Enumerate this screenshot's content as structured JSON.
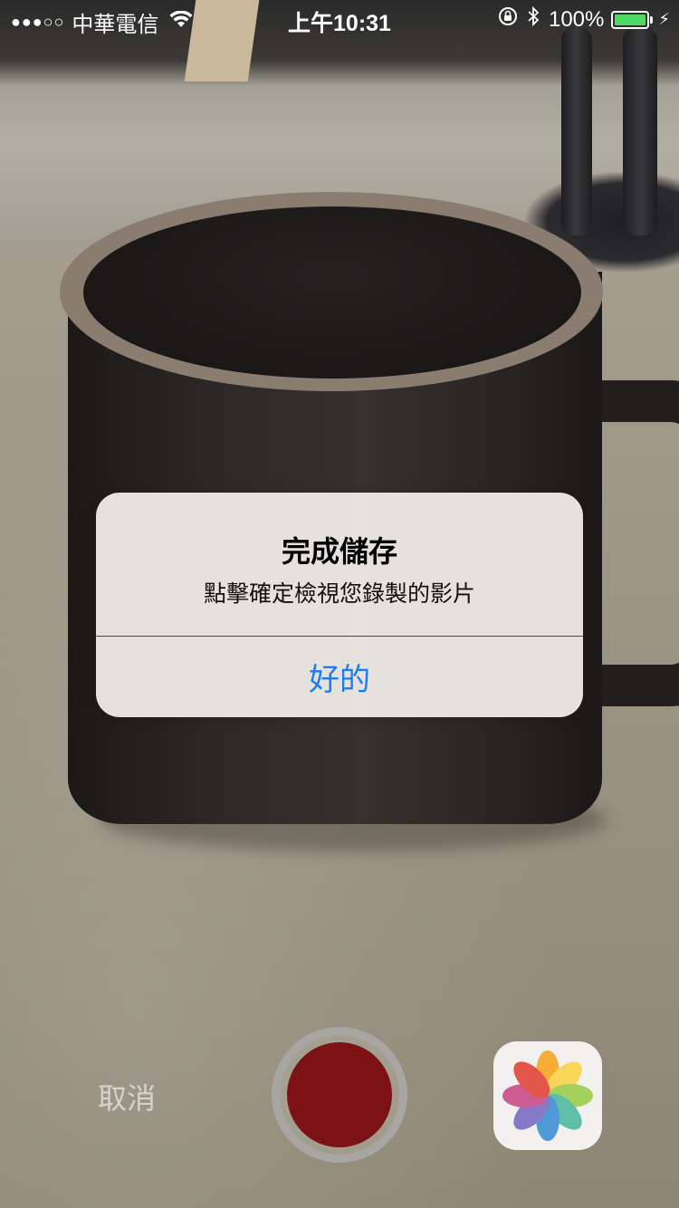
{
  "status_bar": {
    "signal_dots": "●●●○○",
    "carrier": "中華電信",
    "time": "上午10:31",
    "battery_percent": "100%",
    "battery_level": 1.0,
    "icons": [
      "wifi-icon",
      "orientation-lock-icon",
      "bluetooth-icon",
      "battery-icon",
      "charging-icon"
    ]
  },
  "alert": {
    "title": "完成儲存",
    "message": "點擊確定檢視您錄製的影片",
    "button_label": "好的",
    "button_color": "#1c7cf4"
  },
  "camera_controls": {
    "cancel_label": "取消",
    "record_button_color": "#7c1213",
    "photos_icon": "photos-app-icon"
  }
}
